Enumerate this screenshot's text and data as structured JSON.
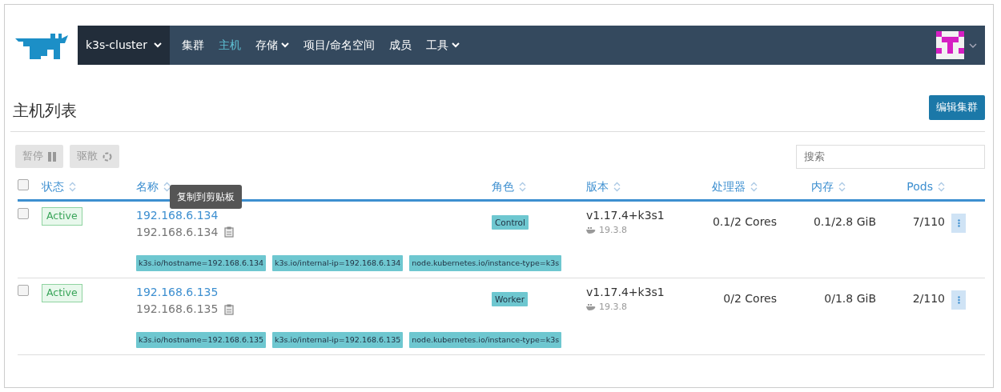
{
  "navbar": {
    "cluster": "k3s-cluster",
    "items": [
      {
        "label": "集群",
        "selected": false,
        "dropdown": false
      },
      {
        "label": "主机",
        "selected": true,
        "dropdown": false
      },
      {
        "label": "存储",
        "selected": false,
        "dropdown": true
      },
      {
        "label": "项目/命名空间",
        "selected": false,
        "dropdown": false
      },
      {
        "label": "成员",
        "selected": false,
        "dropdown": false
      },
      {
        "label": "工具",
        "selected": false,
        "dropdown": true
      }
    ]
  },
  "page": {
    "title": "主机列表",
    "edit_button": "编辑集群"
  },
  "bulk_actions": [
    {
      "label": "暂停",
      "kind": "pause",
      "disabled": true
    },
    {
      "label": "驱散",
      "kind": "drain",
      "disabled": true
    }
  ],
  "search": {
    "placeholder": "搜索"
  },
  "table": {
    "select_all": {
      "checked": false
    },
    "columns": [
      {
        "label": "状态"
      },
      {
        "label": "名称"
      },
      {
        "label": "角色"
      },
      {
        "label": "版本"
      },
      {
        "label": "处理器"
      },
      {
        "label": "内存"
      },
      {
        "label": "Pods"
      }
    ],
    "rows": [
      {
        "selected": false,
        "status": "Active",
        "name": "192.168.6.134",
        "ip": "192.168.6.134",
        "role": "Control",
        "version": "v1.17.4+k3s1",
        "docker": "19.3.8",
        "cpu": "0.1/2 Cores",
        "memory": "0.1/2.8 GiB",
        "pods": "7/110",
        "labels": [
          "k3s.io/hostname=192.168.6.134",
          "k3s.io/internal-ip=192.168.6.134",
          "node.kubernetes.io/instance-type=k3s"
        ]
      },
      {
        "selected": false,
        "status": "Active",
        "name": "192.168.6.135",
        "ip": "192.168.6.135",
        "role": "Worker",
        "version": "v1.17.4+k3s1",
        "docker": "19.3.8",
        "cpu": "0/2 Cores",
        "memory": "0/1.8 GiB",
        "pods": "2/110",
        "labels": [
          "k3s.io/hostname=192.168.6.135",
          "k3s.io/internal-ip=192.168.6.135",
          "node.kubernetes.io/instance-type=k3s"
        ]
      }
    ]
  },
  "tooltip": {
    "text": "复制到剪贴板"
  }
}
